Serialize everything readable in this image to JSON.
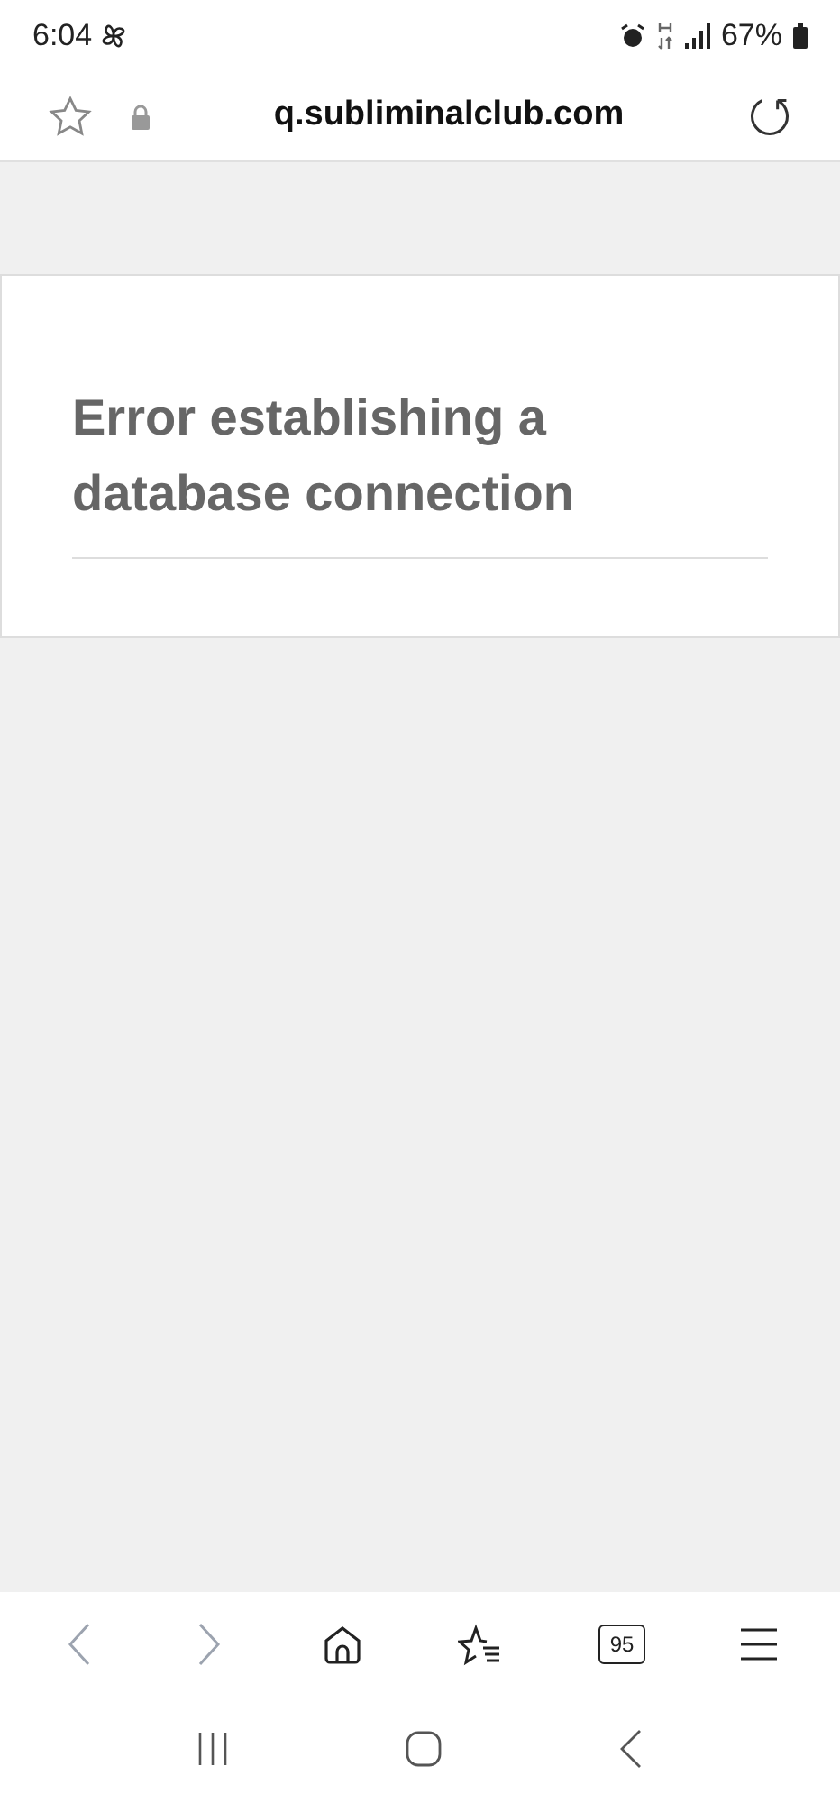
{
  "status_bar": {
    "time": "6:04",
    "battery": "67%"
  },
  "address_bar": {
    "url": "q.subliminalclub.com"
  },
  "page": {
    "error": "Error establishing a database connection"
  },
  "toolbar": {
    "back_disabled": true,
    "forward_disabled": true,
    "tab_count": "95"
  }
}
